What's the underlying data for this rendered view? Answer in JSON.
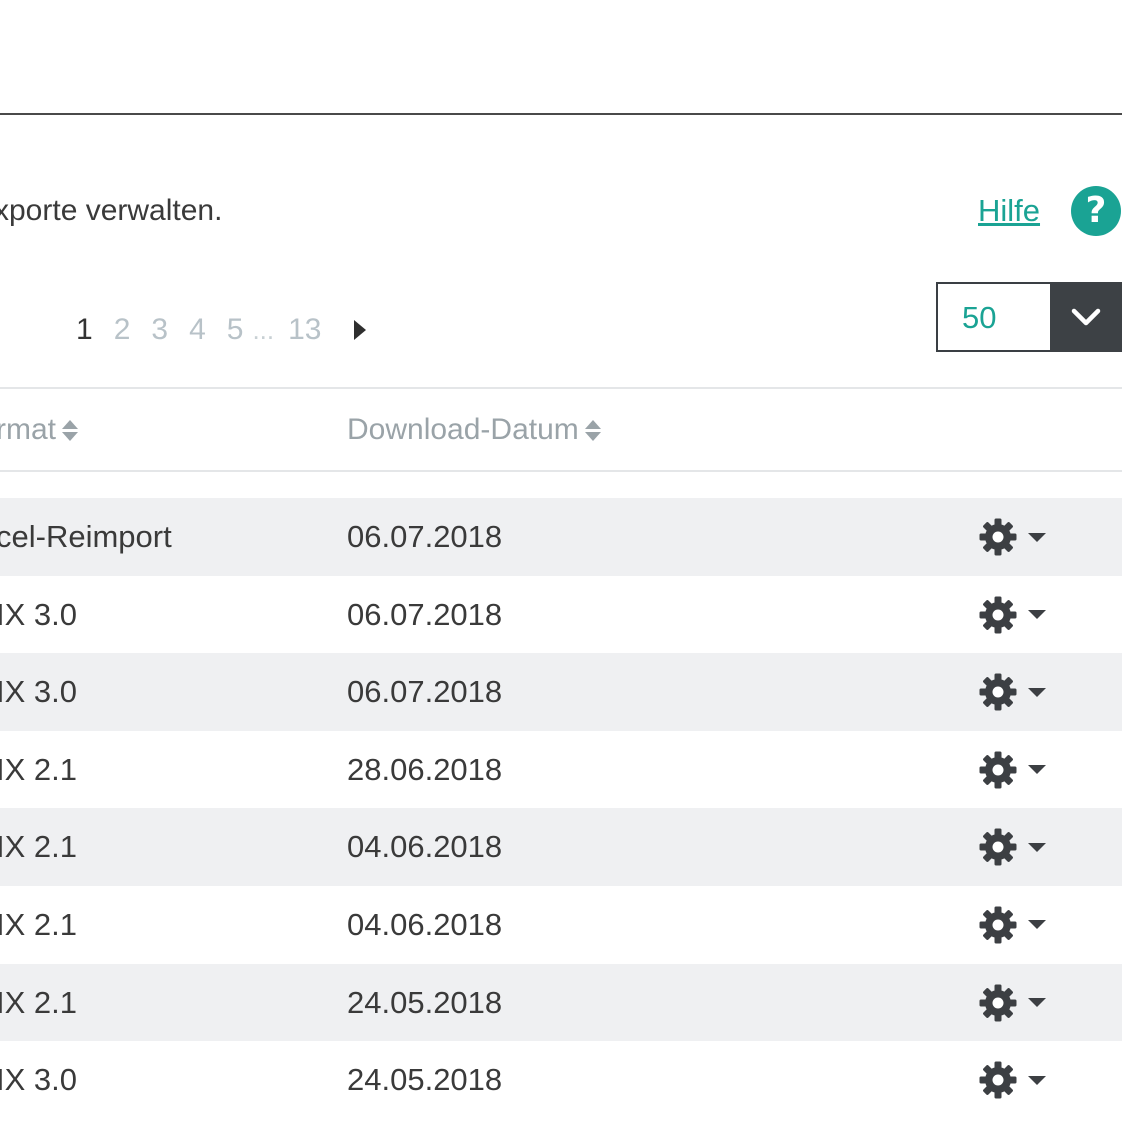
{
  "header": {
    "description": "xporte verwalten.",
    "help_label": "Hilfe",
    "help_icon_glyph": "?"
  },
  "pagination": {
    "pages": [
      "1",
      "2",
      "3",
      "4",
      "5"
    ],
    "current": "1",
    "ellipsis": "...",
    "last": "13",
    "next_icon": "caret-right-icon"
  },
  "per_page": {
    "value": "50",
    "icon": "chevron-down-icon"
  },
  "table": {
    "columns": [
      {
        "label": "rmat"
      },
      {
        "label": "Download-Datum"
      }
    ],
    "rows": [
      {
        "format": "cel-Reimport",
        "date": "06.07.2018"
      },
      {
        "format": "IX 3.0",
        "date": "06.07.2018"
      },
      {
        "format": "IX 3.0",
        "date": "06.07.2018"
      },
      {
        "format": "IX 2.1",
        "date": "28.06.2018"
      },
      {
        "format": "IX 2.1",
        "date": "04.06.2018"
      },
      {
        "format": "IX 2.1",
        "date": "04.06.2018"
      },
      {
        "format": "IX 2.1",
        "date": "24.05.2018"
      },
      {
        "format": "IX 3.0",
        "date": "24.05.2018"
      }
    ],
    "row_action_icon": "gear-icon"
  },
  "colors": {
    "accent": "#1aa394",
    "dark": "#3d4145",
    "row_shade": "#eff0f2"
  }
}
